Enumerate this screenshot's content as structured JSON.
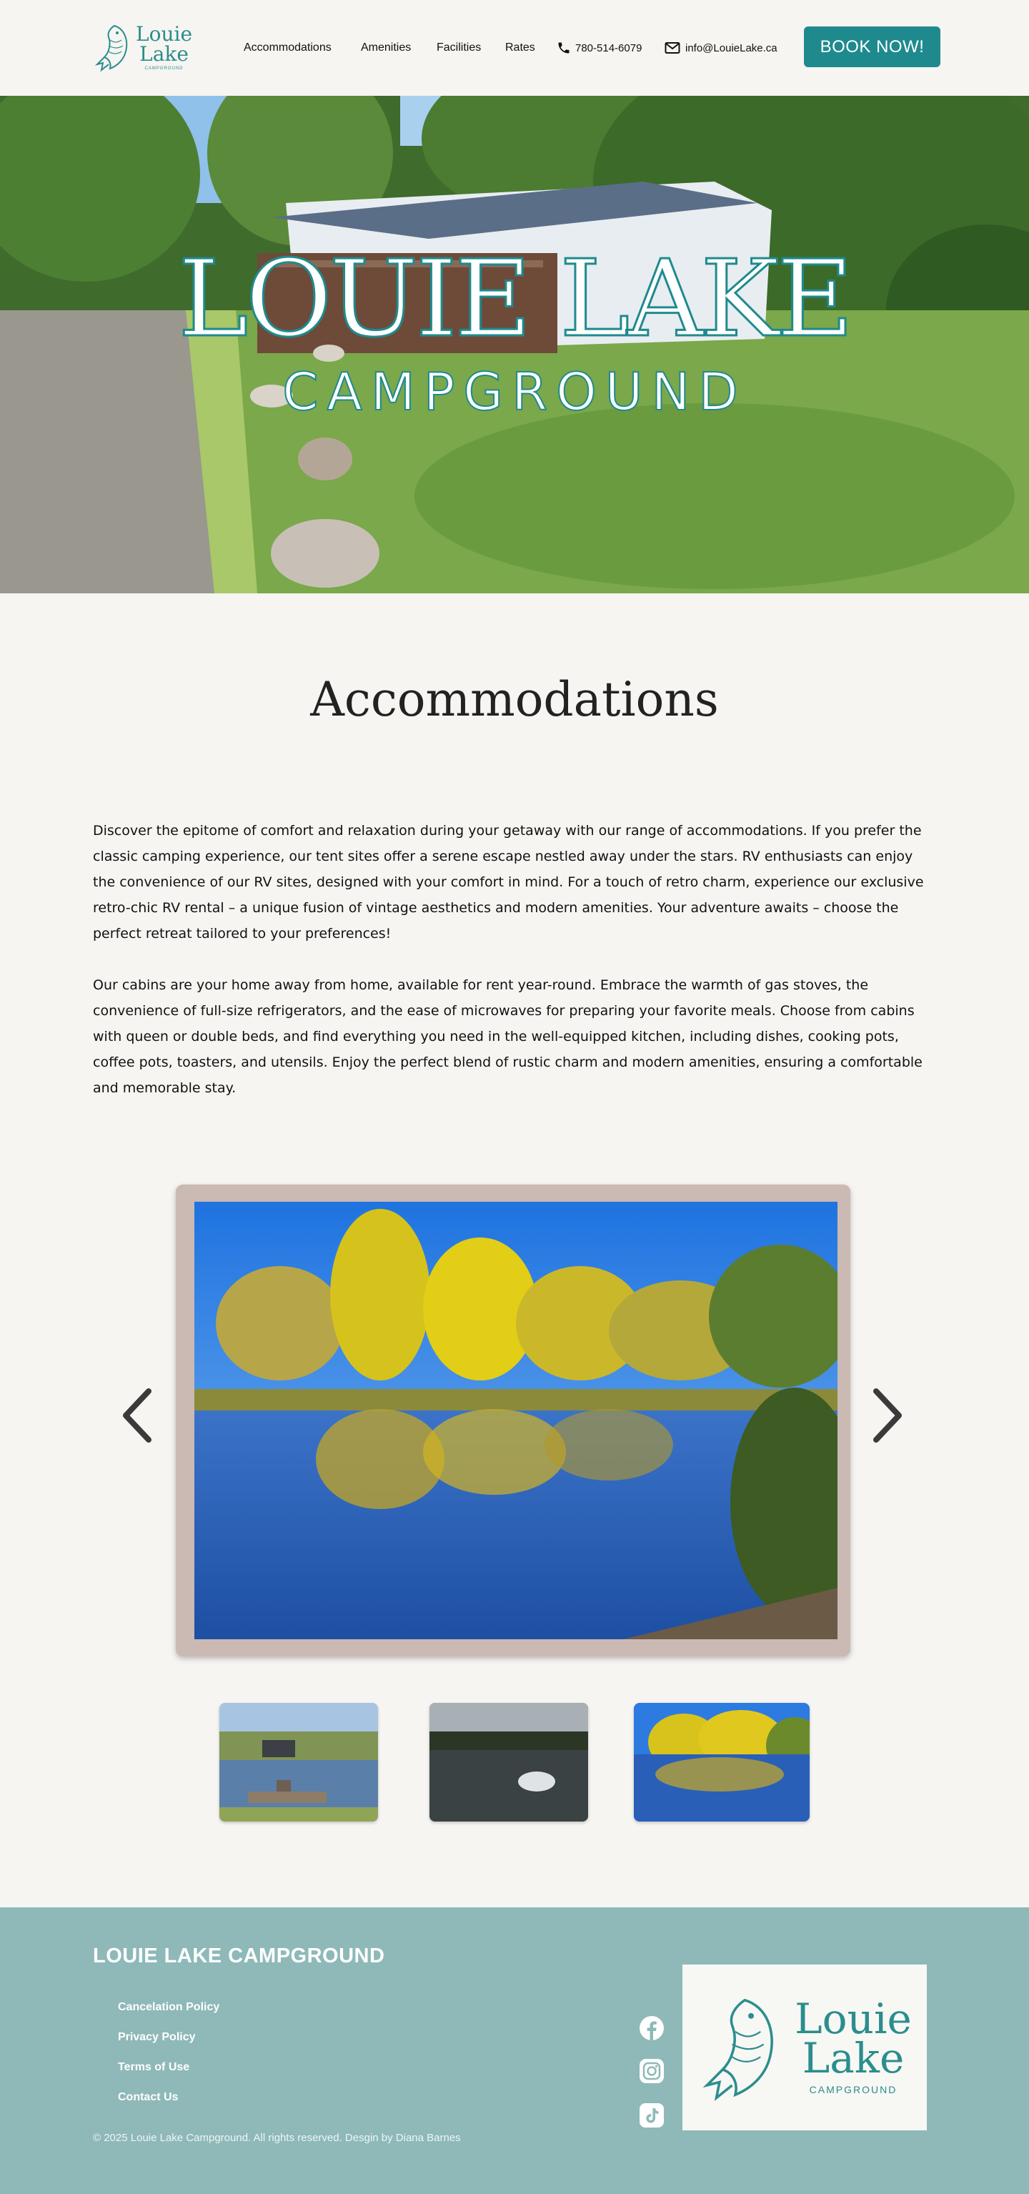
{
  "brand": {
    "logo_line1": "Louie",
    "logo_line2": "Lake",
    "logo_line3": "CAMPGROUND",
    "accent_color": "#1f8a8e"
  },
  "nav": {
    "items": [
      {
        "label": "Accommodations"
      },
      {
        "label": "Amenities"
      },
      {
        "label": "Facilities"
      },
      {
        "label": "Rates"
      }
    ],
    "phone": "780-514-6079",
    "email": "info@LouieLake.ca",
    "book_label": "BOOK NOW!"
  },
  "hero": {
    "title": "LOUIE LAKE",
    "subtitle": "CAMPGROUND"
  },
  "main": {
    "heading": "Accommodations",
    "paragraphs": [
      "Discover the epitome of comfort and relaxation during your getaway with our range of accommodations. If you prefer the classic camping experience, our tent sites offer a serene escape nestled away under the stars. RV enthusiasts can enjoy the convenience of our RV sites, designed with your comfort in mind. For a touch of retro charm, experience our exclusive retro-chic RV rental – a unique fusion of vintage aesthetics and modern amenities. Your adventure awaits – choose the perfect retreat tailored to your preferences!",
      "Our cabins are your home away from home, available for rent year-round. Embrace the warmth of gas stoves, the convenience of full-size refrigerators, and the ease of microwaves for preparing your favorite meals. Choose from cabins with queen or double beds, and find everything you need in the well-equipped kitchen, including dishes, cooking pots, coffee pots, toasters, and utensils. Enjoy the perfect blend of rustic charm and modern amenities, ensuring a comfortable and memorable stay."
    ]
  },
  "gallery": {
    "prev_icon": "chevron-left-icon",
    "next_icon": "chevron-right-icon"
  },
  "footer": {
    "title": "LOUIE LAKE CAMPGROUND",
    "links": [
      {
        "label": "Cancelation Policy"
      },
      {
        "label": "Privacy Policy"
      },
      {
        "label": "Terms of Use"
      },
      {
        "label": "Contact Us"
      }
    ],
    "copyright": "© 2025 Louie Lake Campground. All rights reserved. Desgin by Diana Barnes",
    "social": [
      "facebook-icon",
      "instagram-icon",
      "tiktok-icon"
    ],
    "background_color": "#8eb9b8"
  }
}
